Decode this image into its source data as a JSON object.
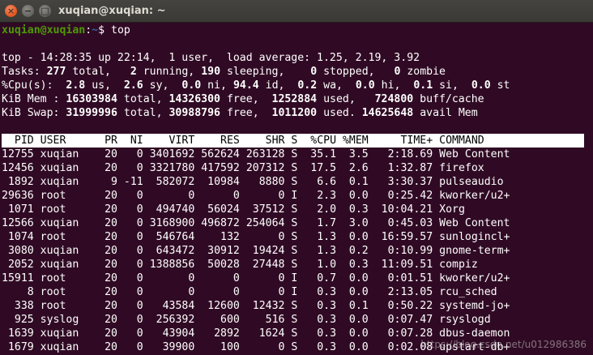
{
  "window": {
    "title": "xuqian@xuqian: ~"
  },
  "prompt": {
    "user_host": "xuqian@xuqian",
    "sep": ":",
    "path": "~",
    "symbol": "$ ",
    "command": "top"
  },
  "summary": {
    "top_line": "top - 14:28:35 up 22:14,  1 user,  load average: 1.25, 2.19, 3.92",
    "tasks": {
      "label": "Tasks:",
      "total": "277",
      "total_label": " total,",
      "running": "2",
      "running_label": " running,",
      "sleeping": "190",
      "sleeping_label": " sleeping,",
      "stopped": "0",
      "stopped_label": " stopped,",
      "zombie": "0",
      "zombie_label": " zombie"
    },
    "cpu": {
      "label": "%Cpu(s):",
      "us": "2.8",
      "us_label": " us,",
      "sy": "2.6",
      "sy_label": " sy,",
      "ni": "0.0",
      "ni_label": " ni,",
      "id": "94.4",
      "id_label": " id,",
      "wa": "0.2",
      "wa_label": " wa,",
      "hi": "0.0",
      "hi_label": " hi,",
      "si": "0.1",
      "si_label": " si,",
      "st": "0.0",
      "st_label": " st"
    },
    "mem": {
      "label": "KiB Mem :",
      "total": "16303984",
      "total_label": " total,",
      "free": "14326300",
      "free_label": " free,",
      "used": "1252884",
      "used_label": " used,",
      "buff": "724800",
      "buff_label": " buff/cache"
    },
    "swap": {
      "label": "KiB Swap:",
      "total": "31999996",
      "total_label": " total,",
      "free": "30988796",
      "free_label": " free,",
      "used": "1011200",
      "used_label": " used.",
      "avail": "14625648",
      "avail_label": " avail Mem"
    }
  },
  "table": {
    "columns": [
      "PID",
      "USER",
      "PR",
      "NI",
      "VIRT",
      "RES",
      "SHR",
      "S",
      "%CPU",
      "%MEM",
      "TIME+",
      "COMMAND"
    ],
    "rows": [
      [
        "12755",
        "xuqian",
        "20",
        "0",
        "3401692",
        "562624",
        "263128",
        "S",
        "35.1",
        "3.5",
        "2:18.69",
        "Web Content"
      ],
      [
        "12456",
        "xuqian",
        "20",
        "0",
        "3321780",
        "417592",
        "207312",
        "S",
        "17.5",
        "2.6",
        "1:32.87",
        "firefox"
      ],
      [
        "1892",
        "xuqian",
        "9",
        "-11",
        "582072",
        "10984",
        "8880",
        "S",
        "6.6",
        "0.1",
        "3:30.37",
        "pulseaudio"
      ],
      [
        "29636",
        "root",
        "20",
        "0",
        "0",
        "0",
        "0",
        "I",
        "2.3",
        "0.0",
        "0:25.42",
        "kworker/u2+"
      ],
      [
        "1071",
        "root",
        "20",
        "0",
        "494740",
        "56024",
        "37512",
        "S",
        "2.0",
        "0.3",
        "10:04.21",
        "Xorg"
      ],
      [
        "12566",
        "xuqian",
        "20",
        "0",
        "3168900",
        "496872",
        "254064",
        "S",
        "1.7",
        "3.0",
        "0:45.03",
        "Web Content"
      ],
      [
        "1074",
        "root",
        "20",
        "0",
        "546764",
        "132",
        "0",
        "S",
        "1.3",
        "0.0",
        "16:59.57",
        "sunlogincl+"
      ],
      [
        "3080",
        "xuqian",
        "20",
        "0",
        "643472",
        "30912",
        "19424",
        "S",
        "1.3",
        "0.2",
        "0:10.99",
        "gnome-term+"
      ],
      [
        "2052",
        "xuqian",
        "20",
        "0",
        "1388856",
        "50028",
        "27448",
        "S",
        "1.0",
        "0.3",
        "11:09.51",
        "compiz"
      ],
      [
        "15911",
        "root",
        "20",
        "0",
        "0",
        "0",
        "0",
        "I",
        "0.7",
        "0.0",
        "0:01.51",
        "kworker/u2+"
      ],
      [
        "8",
        "root",
        "20",
        "0",
        "0",
        "0",
        "0",
        "I",
        "0.3",
        "0.0",
        "2:13.05",
        "rcu_sched"
      ],
      [
        "338",
        "root",
        "20",
        "0",
        "43584",
        "12600",
        "12432",
        "S",
        "0.3",
        "0.1",
        "0:50.22",
        "systemd-jo+"
      ],
      [
        "925",
        "syslog",
        "20",
        "0",
        "256392",
        "600",
        "516",
        "S",
        "0.3",
        "0.0",
        "0:07.47",
        "rsyslogd"
      ],
      [
        "1639",
        "xuqian",
        "20",
        "0",
        "43904",
        "2892",
        "1624",
        "S",
        "0.3",
        "0.0",
        "0:07.28",
        "dbus-daemon"
      ],
      [
        "1679",
        "xuqian",
        "20",
        "0",
        "39900",
        "100",
        "0",
        "S",
        "0.3",
        "0.0",
        "0:02.08",
        "upstart-db+"
      ]
    ]
  },
  "watermark": "https://blog.csdn.net/u012986386"
}
